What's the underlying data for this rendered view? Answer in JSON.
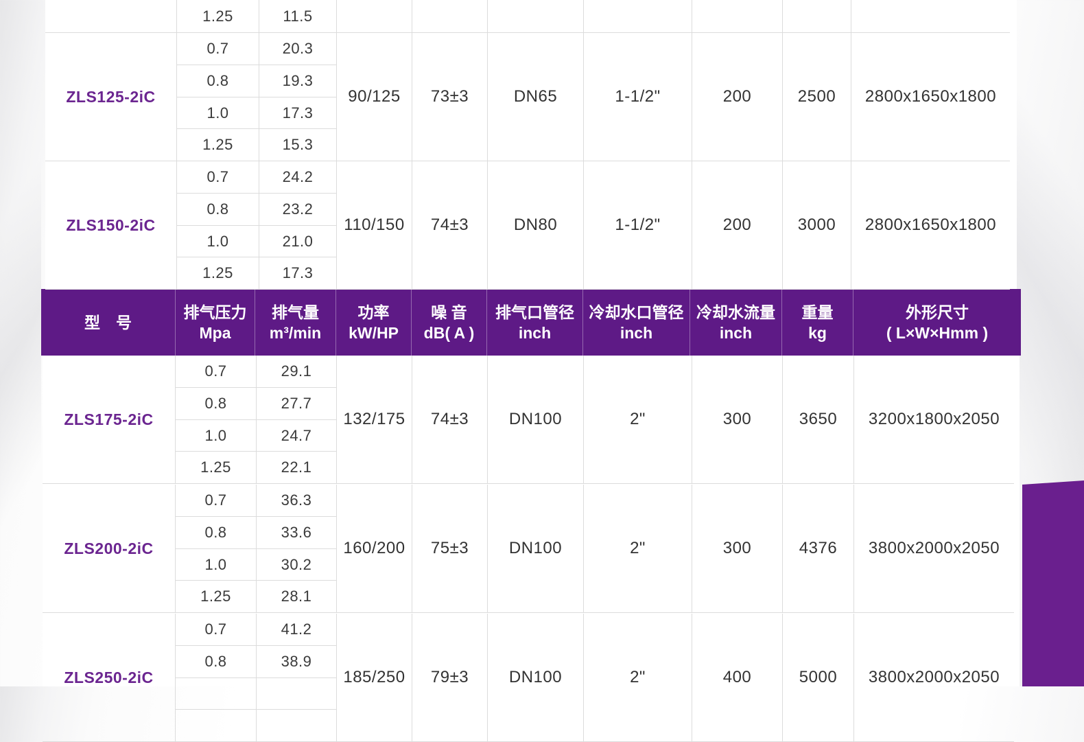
{
  "header": {
    "columns": [
      {
        "l1": "型　号",
        "l2": ""
      },
      {
        "l1": "排气压力",
        "l2": "Mpa"
      },
      {
        "l1": "排气量",
        "l2": "m³/min"
      },
      {
        "l1": "功率",
        "l2": "kW/HP"
      },
      {
        "l1": "噪 音",
        "l2": "dB( A )"
      },
      {
        "l1": "排气口管径",
        "l2": "inch"
      },
      {
        "l1": "冷却水口管径",
        "l2": "inch"
      },
      {
        "l1": "冷却水流量",
        "l2": "inch"
      },
      {
        "l1": "重量",
        "l2": "kg"
      },
      {
        "l1": "外形尺寸",
        "l2": "( L×W×Hmm )"
      }
    ]
  },
  "top_partial": {
    "pressure": "1.25",
    "flow": "11.5"
  },
  "models": [
    {
      "model": "ZLS125-2iC",
      "pressures": [
        "0.7",
        "0.8",
        "1.0",
        "1.25"
      ],
      "flows": [
        "20.3",
        "19.3",
        "17.3",
        "15.3"
      ],
      "power": "90/125",
      "noise": "73±3",
      "outlet": "DN65",
      "water_pipe": "1-1/2\"",
      "water_flow": "200",
      "weight": "2500",
      "size": "2800x1650x1800"
    },
    {
      "model": "ZLS150-2iC",
      "pressures": [
        "0.7",
        "0.8",
        "1.0",
        "1.25"
      ],
      "flows": [
        "24.2",
        "23.2",
        "21.0",
        "17.3"
      ],
      "power": "110/150",
      "noise": "74±3",
      "outlet": "DN80",
      "water_pipe": "1-1/2\"",
      "water_flow": "200",
      "weight": "3000",
      "size": "2800x1650x1800"
    },
    {
      "model": "ZLS175-2iC",
      "pressures": [
        "0.7",
        "0.8",
        "1.0",
        "1.25"
      ],
      "flows": [
        "29.1",
        "27.7",
        "24.7",
        "22.1"
      ],
      "power": "132/175",
      "noise": "74±3",
      "outlet": "DN100",
      "water_pipe": "2\"",
      "water_flow": "300",
      "weight": "3650",
      "size": "3200x1800x2050"
    },
    {
      "model": "ZLS200-2iC",
      "pressures": [
        "0.7",
        "0.8",
        "1.0",
        "1.25"
      ],
      "flows": [
        "36.3",
        "33.6",
        "30.2",
        "28.1"
      ],
      "power": "160/200",
      "noise": "75±3",
      "outlet": "DN100",
      "water_pipe": "2\"",
      "water_flow": "300",
      "weight": "4376",
      "size": "3800x2000x2050"
    },
    {
      "model": "ZLS250-2iC",
      "pressures": [
        "0.7",
        "0.8"
      ],
      "flows": [
        "41.2",
        "38.9"
      ],
      "power": "185/250",
      "noise": "79±3",
      "outlet": "DN100",
      "water_pipe": "2\"",
      "water_flow": "400",
      "weight": "5000",
      "size": "3800x2000x2050"
    }
  ]
}
